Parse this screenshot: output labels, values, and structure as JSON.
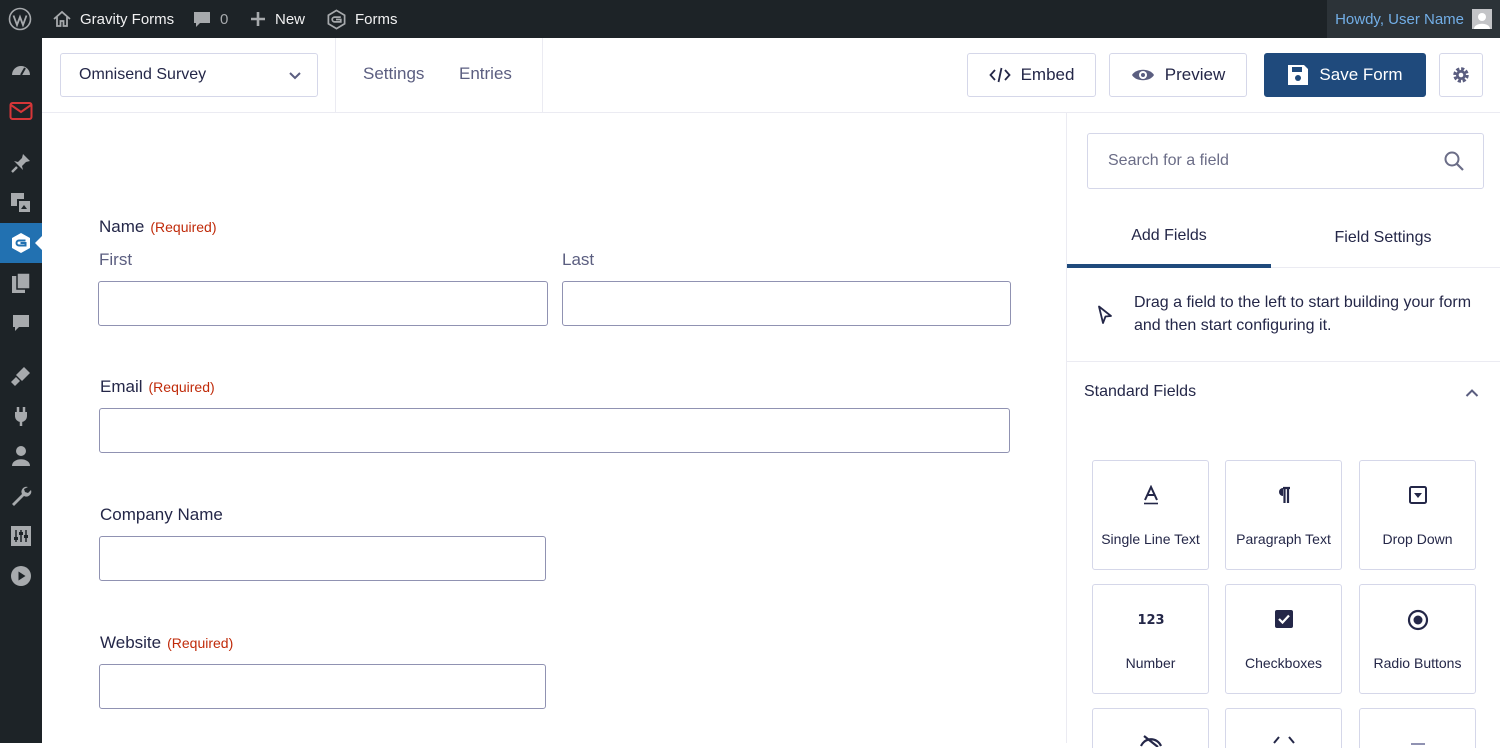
{
  "adminbar": {
    "site_name": "Gravity Forms",
    "comments_count": "0",
    "new_label": "New",
    "forms_label": "Forms",
    "howdy": "Howdy, User Name"
  },
  "toolbar": {
    "form_name": "Omnisend Survey",
    "settings_label": "Settings",
    "entries_label": "Entries",
    "embed_label": "Embed",
    "preview_label": "Preview",
    "save_label": "Save Form"
  },
  "form": {
    "name": {
      "label": "Name",
      "required": "(Required)",
      "first": "First",
      "last": "Last"
    },
    "email": {
      "label": "Email",
      "required": "(Required)"
    },
    "company": {
      "label": "Company Name"
    },
    "website": {
      "label": "Website",
      "required": "(Required)"
    }
  },
  "sidebar": {
    "search_placeholder": "Search for a field",
    "tabs": [
      {
        "label": "Add Fields"
      },
      {
        "label": "Field Settings"
      }
    ],
    "hint": "Drag a field to the left to start building your form and then start configuring it.",
    "section_title": "Standard Fields",
    "fields": [
      {
        "label": "Single Line Text",
        "icon": "single-line-text-icon"
      },
      {
        "label": "Paragraph Text",
        "icon": "paragraph-icon"
      },
      {
        "label": "Drop Down",
        "icon": "dropdown-icon"
      },
      {
        "label": "Number",
        "icon": "number-icon"
      },
      {
        "label": "Checkboxes",
        "icon": "checkbox-icon"
      },
      {
        "label": "Radio Buttons",
        "icon": "radio-icon"
      }
    ]
  },
  "colors": {
    "primary": "#1f4a7c",
    "adminbar": "#1d2327",
    "required": "#c02b0a",
    "active_menu": "#2271b1"
  }
}
